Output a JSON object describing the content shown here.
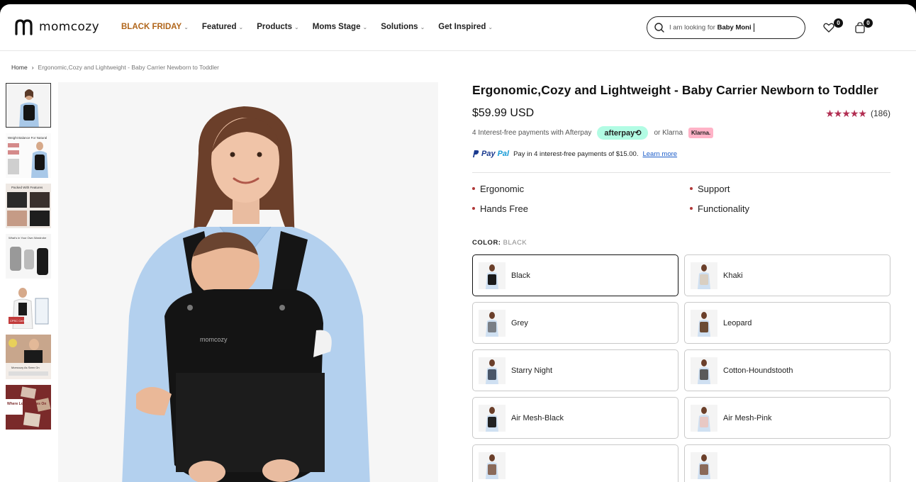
{
  "brand": {
    "name": "momcozy"
  },
  "nav": [
    {
      "label": "BLACK FRIDAY",
      "hot": true
    },
    {
      "label": "Featured"
    },
    {
      "label": "Products"
    },
    {
      "label": "Moms Stage"
    },
    {
      "label": "Solutions"
    },
    {
      "label": "Get Inspired"
    }
  ],
  "search": {
    "prefix": "I am looking for",
    "value": "Baby Moni"
  },
  "header": {
    "wishlist_count": "0",
    "cart_count": "0"
  },
  "breadcrumb": {
    "home": "Home",
    "current": "Ergonomic,Cozy and Lightweight - Baby Carrier Newborn to Toddler"
  },
  "thumbnails": [
    {
      "text": ""
    },
    {
      "text": "Weight Balance For Natural"
    },
    {
      "text": "Packed With Features"
    },
    {
      "text": "What's in Your Own Wardrobe"
    },
    {
      "text": "CPSC Certified"
    },
    {
      "text": "Momcozy As Seen On"
    },
    {
      "text": "Where Love Carries On"
    }
  ],
  "product": {
    "title": "Ergonomic,Cozy and Lightweight - Baby Carrier Newborn to Toddler",
    "price": "$59.99 USD",
    "stars": "★★★★★",
    "reviews": "(186)",
    "afterpay_text": "4 Interest-free payments with Afterpay",
    "afterpay_badge": "afterpay⟲",
    "klarna_text": "or Klarna",
    "klarna_badge": "Klarna.",
    "paypal_logo_a": "Pay",
    "paypal_logo_b": "Pal",
    "paypal_text": "Pay in 4 interest-free payments of $15.00.",
    "paypal_link": "Learn more",
    "carrier_logo": "momcozy",
    "features": [
      "Ergonomic",
      "Support",
      "Hands Free",
      "Functionality"
    ],
    "color_label": "COLOR:",
    "color_value": "BLACK",
    "colors": [
      {
        "name": "Black",
        "hex": "#1a1a1a",
        "selected": true
      },
      {
        "name": "Khaki",
        "hex": "#d9cfc2"
      },
      {
        "name": "Grey",
        "hex": "#7a7f86"
      },
      {
        "name": "Leopard",
        "hex": "#6b4b35"
      },
      {
        "name": "Starry Night",
        "hex": "#4a5668"
      },
      {
        "name": "Cotton-Houndstooth",
        "hex": "#5a5a5a"
      },
      {
        "name": "Air Mesh-Black",
        "hex": "#222222"
      },
      {
        "name": "Air Mesh-Pink",
        "hex": "#e8c8c4"
      },
      {
        "name": "",
        "hex": "#8a6a5a"
      },
      {
        "name": "",
        "hex": "#8a6a5a"
      }
    ]
  },
  "colors": {
    "accent": "#b0651a",
    "star": "#b22e52",
    "bullet": "#b03838"
  }
}
